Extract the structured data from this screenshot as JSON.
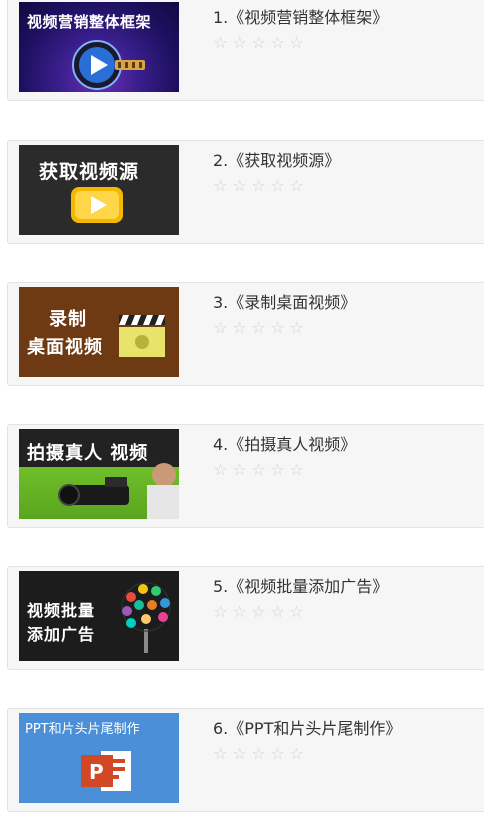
{
  "courses": [
    {
      "title": "1.《视频营销整体框架》",
      "thumb_text": [
        "视频营销整体框架"
      ],
      "stars": [
        "☆",
        "☆",
        "☆",
        "☆",
        "☆"
      ]
    },
    {
      "title": "2.《获取视频源》",
      "thumb_text": [
        "获取视频源"
      ],
      "stars": [
        "☆",
        "☆",
        "☆",
        "☆",
        "☆"
      ]
    },
    {
      "title": "3.《录制桌面视频》",
      "thumb_text": [
        "录制",
        "桌面视频"
      ],
      "stars": [
        "☆",
        "☆",
        "☆",
        "☆",
        "☆"
      ]
    },
    {
      "title": "4.《拍摄真人视频》",
      "thumb_text": [
        "拍摄真人 视频"
      ],
      "stars": [
        "☆",
        "☆",
        "☆",
        "☆",
        "☆"
      ]
    },
    {
      "title": "5.《视频批量添加广告》",
      "thumb_text": [
        "视频批量",
        "添加广告"
      ],
      "stars": [
        "☆",
        "☆",
        "☆",
        "☆",
        "☆"
      ]
    },
    {
      "title": "6.《PPT和片头片尾制作》",
      "thumb_text": [
        "PPT和片头片尾制作"
      ],
      "stars": [
        "☆",
        "☆",
        "☆",
        "☆",
        "☆"
      ]
    }
  ],
  "rating": {
    "filled": 0,
    "max": 5
  },
  "colors": {
    "card_bg": "#f6f6f6",
    "card_border": "#e3e3e3",
    "title": "#333333",
    "star": "#d2d2d2"
  }
}
